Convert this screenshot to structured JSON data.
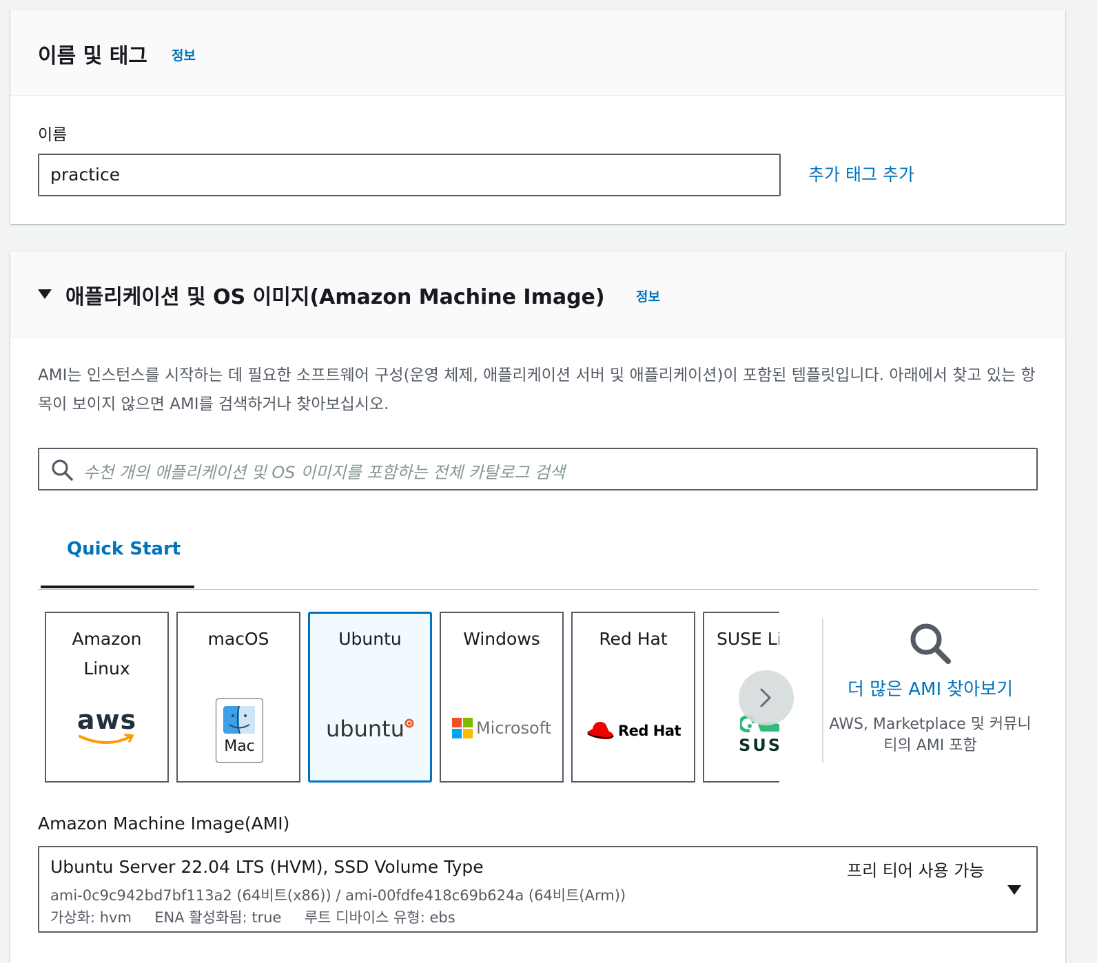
{
  "name_section": {
    "title": "이름 및 태그",
    "info": "정보",
    "name_label": "이름",
    "name_value": "practice",
    "add_tag": "추가 태그 추가"
  },
  "ami_section": {
    "title": "애플리케이션 및 OS 이미지(Amazon Machine Image)",
    "info": "정보",
    "description": "AMI는 인스턴스를 시작하는 데 필요한 소프트웨어 구성(운영 체제, 애플리케이션 서버 및 애플리케이션)이 포함된 템플릿입니다. 아래에서 찾고 있는 항목이 보이지 않으면 AMI를 검색하거나 찾아보십시오.",
    "search_placeholder": "수천 개의 애플리케이션 및 OS 이미지를 포함하는 전체 카탈로그 검색",
    "tab": "Quick Start",
    "tiles": [
      {
        "label": "Amazon Linux",
        "logo_text": "aws",
        "icon": "aws-logo-icon"
      },
      {
        "label": "macOS",
        "logo_text": "Mac",
        "icon": "mac-finder-icon"
      },
      {
        "label": "Ubuntu",
        "logo_text": "ubuntu",
        "icon": "ubuntu-logo-icon",
        "selected": true
      },
      {
        "label": "Windows",
        "logo_text": "Microsoft",
        "icon": "microsoft-logo-icon"
      },
      {
        "label": "Red Hat",
        "logo_text": "Red Hat",
        "icon": "redhat-logo-icon"
      },
      {
        "label": "SUSE Li",
        "logo_text": "SUS",
        "icon": "suse-logo-icon"
      }
    ],
    "browse_more": {
      "title": "더 많은 AMI 찾아보기",
      "subtitle": "AWS, Marketplace 및 커뮤니티의 AMI 포함"
    },
    "ami_label": "Amazon Machine Image(AMI)",
    "selected_ami": {
      "name": "Ubuntu Server 22.04 LTS (HVM), SSD Volume Type",
      "ids": "ami-0c9c942bd7bf113a2 (64비트(x86)) / ami-00fdfe418c69b624a (64비트(Arm))",
      "meta": "가상화: hvm     ENA 활성화됨: true     루트 디바이스 유형: ebs",
      "free_tier": "프리 티어 사용 가능"
    }
  },
  "colors": {
    "link": "#0073bb",
    "selected_border": "#0073bb",
    "text": "#16191f",
    "secondary_text": "#545b64"
  }
}
